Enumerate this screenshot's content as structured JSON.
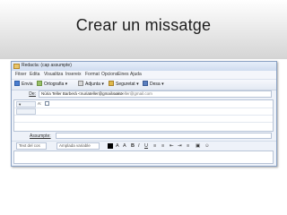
{
  "slide": {
    "title": "Crear un missatge"
  },
  "window": {
    "title": "Redacta: (cap assumpte)",
    "menu": [
      "Fitxer",
      "Edita",
      "Visualitza",
      "Insereix",
      "Format",
      "Opcions",
      "Eines",
      "Ajuda"
    ],
    "toolbar": {
      "send": "Envia",
      "spelling": "Ortografia",
      "attach": "Adjunta",
      "security": "Seguretat",
      "save": "Desa"
    },
    "header": {
      "from_label": "De:",
      "from_value": "Núria Teller Barberà <nuriateller@gmail.com>",
      "from_account": "nuriateller@gmail.com"
    },
    "recipients": [
      {
        "type": "A:",
        "value": ""
      }
    ],
    "subject_label": "Assumpte:",
    "subject_value": "",
    "format": {
      "paragraph": "Text del cos",
      "font": "Amplada variable"
    }
  }
}
